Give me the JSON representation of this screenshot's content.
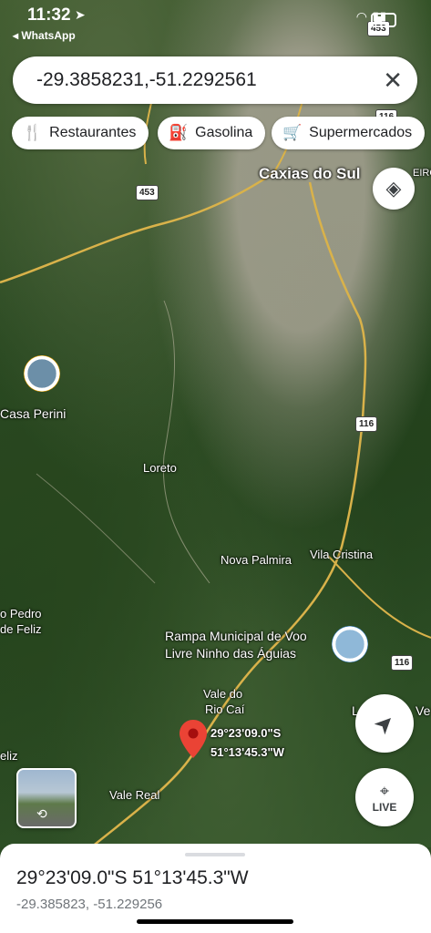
{
  "status_bar": {
    "time": "11:32",
    "back_app": "◂ WhatsApp"
  },
  "search": {
    "value": "-29.3858231,-51.2292561"
  },
  "chips": [
    {
      "icon": "restaurant-icon",
      "label": "Restaurantes"
    },
    {
      "icon": "gas-station-icon",
      "label": "Gasolina"
    },
    {
      "icon": "cart-icon",
      "label": "Supermercados"
    }
  ],
  "map": {
    "city_label": "Caxias do Sul",
    "city_label_partial": "EIRO",
    "place_labels": {
      "casa_perini": "Casa Perini",
      "loreto": "Loreto",
      "nova_palmira": "Nova Palmira",
      "vila_cristina": "Vila Cristina",
      "sao_pedro_feliz_1": "o Pedro",
      "sao_pedro_feliz_2": "de Feliz",
      "rampa_1": "Rampa Municipal de Voo",
      "rampa_2": "Livre Ninho das Águias",
      "vale_rio_cai_1": "Vale do",
      "vale_rio_cai_2": "Rio Caí",
      "vale_real": "Vale Real",
      "feliz_partial": "eliz",
      "right_partial": "Ve",
      "right_partial_l": "L"
    },
    "road_shields": {
      "r453_top": "453",
      "r116_top": "116",
      "r453": "453",
      "r116_mid": "116",
      "r116_low": "116"
    },
    "pin_label_lat": "29°23'09.0\"S",
    "pin_label_lng": "51°13'45.3\"W",
    "live_label": "LIVE"
  },
  "sheet": {
    "title": "29°23'09.0\"S 51°13'45.3\"W",
    "subtitle": "-29.385823, -51.229256"
  },
  "colors": {
    "pin_red": "#ea4335",
    "road_yellow": "#d9b24a"
  }
}
